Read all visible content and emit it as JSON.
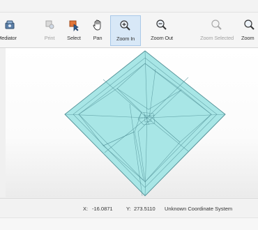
{
  "toolbar": {
    "tools": [
      {
        "label": "Mediator",
        "icon": "layers-icon",
        "state": "enabled"
      },
      {
        "label": "Print",
        "icon": "print-icon",
        "state": "disabled"
      },
      {
        "label": "Select",
        "icon": "select-pointer-icon",
        "state": "enabled"
      },
      {
        "label": "Pan",
        "icon": "hand-pan-icon",
        "state": "enabled"
      },
      {
        "label": "Zoom In",
        "icon": "zoom-in-icon",
        "state": "active"
      },
      {
        "label": "Zoom Out",
        "icon": "zoom-out-icon",
        "state": "enabled"
      },
      {
        "label": "Zoom Selected",
        "icon": "zoom-selected-icon",
        "state": "disabled"
      },
      {
        "label": "Zoom",
        "icon": "zoom-icon",
        "state": "enabled"
      }
    ]
  },
  "map": {
    "fill_color": "#a8e6e6",
    "stroke_color": "#4f8f95"
  },
  "status": {
    "x_label": "X:",
    "x_value": "-16.0871",
    "y_label": "Y:",
    "y_value": "273.5110",
    "crs": "Unknown Coordinate System"
  }
}
